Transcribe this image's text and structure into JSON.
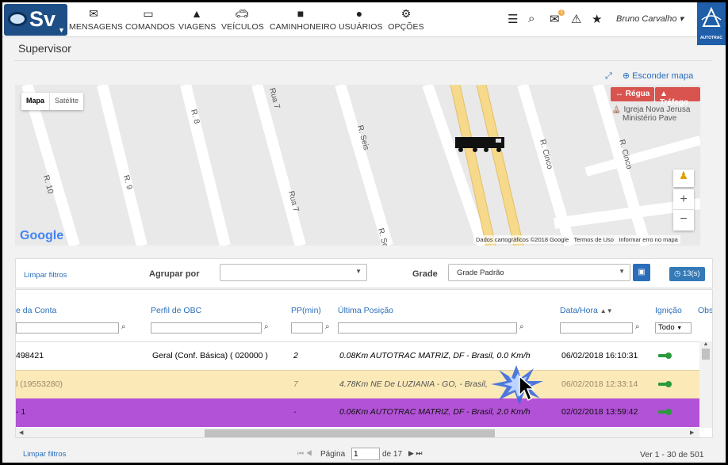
{
  "app": {
    "logo_text": "Sv",
    "brand_text": "AUTOTRAC"
  },
  "nav": [
    {
      "label": "MENSAGENS",
      "icon": "envelope-icon"
    },
    {
      "label": "COMANDOS",
      "icon": "laptop-icon"
    },
    {
      "label": "VIAGENS",
      "icon": "road-icon"
    },
    {
      "label": "VEÍCULOS",
      "icon": "car-icon"
    },
    {
      "label": "CAMINHONEIRO",
      "icon": "truck-icon"
    },
    {
      "label": "USUÁRIOS",
      "icon": "user-icon"
    },
    {
      "label": "OPÇÕES",
      "icon": "cogs-icon"
    }
  ],
  "topright": {
    "user_name": "Bruno Carvalho",
    "badge_count": "1"
  },
  "page": {
    "title": "Supervisor"
  },
  "map": {
    "hide_label": "Esconder mapa",
    "type_map": "Mapa",
    "type_satellite": "Satélite",
    "ruler_label": "Régua",
    "traffic_label": "Tráfego",
    "poi_line1": "Igreja Nova Jerusa",
    "poi_line2": "Ministério Pave",
    "attribution_data": "Dados cartográficos ©2018 Google",
    "attribution_terms": "Termos de Uso",
    "attribution_report": "Informar erro no mapa",
    "google": "Google",
    "streets": [
      "R. 10",
      "R. 9",
      "R. 8",
      "Rua 7",
      "Rua 7",
      "R. Seis",
      "R. Se",
      "R. Cinco",
      "R. Cinco"
    ]
  },
  "filters": {
    "clear_label": "Limpar filtros",
    "group_label": "Agrupar por",
    "group_value": "",
    "grid_label": "Grade",
    "grid_value": "Grade Padrão",
    "count_label": "13(s)"
  },
  "table": {
    "headers": [
      "e da Conta",
      "Perfil de OBC",
      "PP(min)",
      "Última Posição",
      "Data/Hora",
      "Ignição",
      "Obs"
    ],
    "ignition_filter": "Todo",
    "rows": [
      {
        "account": "498421",
        "profile": "Geral (Conf. Básica) ( 020000 )",
        "pp": "2",
        "position": "0.08Km AUTOTRAC MATRIZ, DF - Brasil, 0.0 Km/h",
        "datetime": "06/02/2018 16:10:31"
      },
      {
        "account": "l (19553280)",
        "profile": "",
        "pp": "7",
        "position": "4.78Km NE De LUZIANIA - GO, - Brasil,",
        "datetime": "06/02/2018 12:33:14"
      },
      {
        "account": "- 1",
        "profile": "",
        "pp": "-",
        "position": "0.06Km AUTOTRAC MATRIZ, DF - Brasil, 2.0 Km/h",
        "datetime": "02/02/2018 13:59:42"
      }
    ]
  },
  "pager": {
    "clear_label": "Limpar filtros",
    "page_label": "Página",
    "page_value": "1",
    "of_label": "de 17",
    "range_label": "Ver 1 - 30 de 501"
  },
  "colors": {
    "accent": "#2a6ebb",
    "selected_row": "#fbe9b8",
    "purple_row": "#b252d6"
  }
}
